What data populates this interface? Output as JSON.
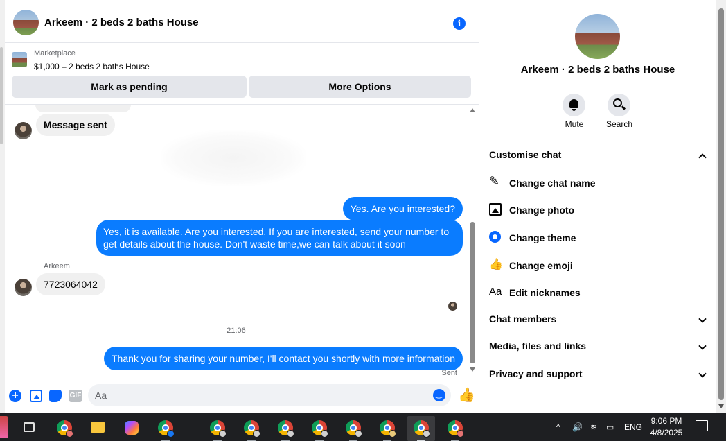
{
  "chat": {
    "title": "Arkeem · 2 beds 2 baths House",
    "marketplace_label": "Marketplace",
    "listing": "$1,000 – 2 beds 2 baths House",
    "mark_pending": "Mark as pending",
    "more_options": "More Options"
  },
  "messages": {
    "m1": "Message sent",
    "m2": "Yes. Are you interested?",
    "m3": "Yes, it is available. Are you interested. If you are interested, send your number to get details about the house. Don't waste time,we can talk about it soon",
    "sender": "Arkeem",
    "m4": "7723064042",
    "time": "21:06",
    "m5": "Thank you for sharing your number, I'll contact you shortly with more information",
    "sent": "Sent"
  },
  "composer": {
    "placeholder": "Aa",
    "gif": "GIF"
  },
  "side": {
    "title": "Arkeem · 2 beds 2 baths House",
    "mute": "Mute",
    "search": "Search",
    "customise": "Customise chat",
    "change_name": "Change chat name",
    "change_photo": "Change photo",
    "change_theme": "Change theme",
    "change_emoji": "Change emoji",
    "edit_nicknames": "Edit nicknames",
    "aa": "Aa",
    "members": "Chat members",
    "media": "Media, files and links",
    "privacy": "Privacy and support"
  },
  "taskbar": {
    "lang": "ENG",
    "time": "9:06 PM",
    "date": "4/8/2025"
  },
  "colors": {
    "accent": "#0866ff",
    "bubble_out": "#0a7cff",
    "bubble_in": "#f0f0f0",
    "taskbar": "#1e1f22"
  }
}
